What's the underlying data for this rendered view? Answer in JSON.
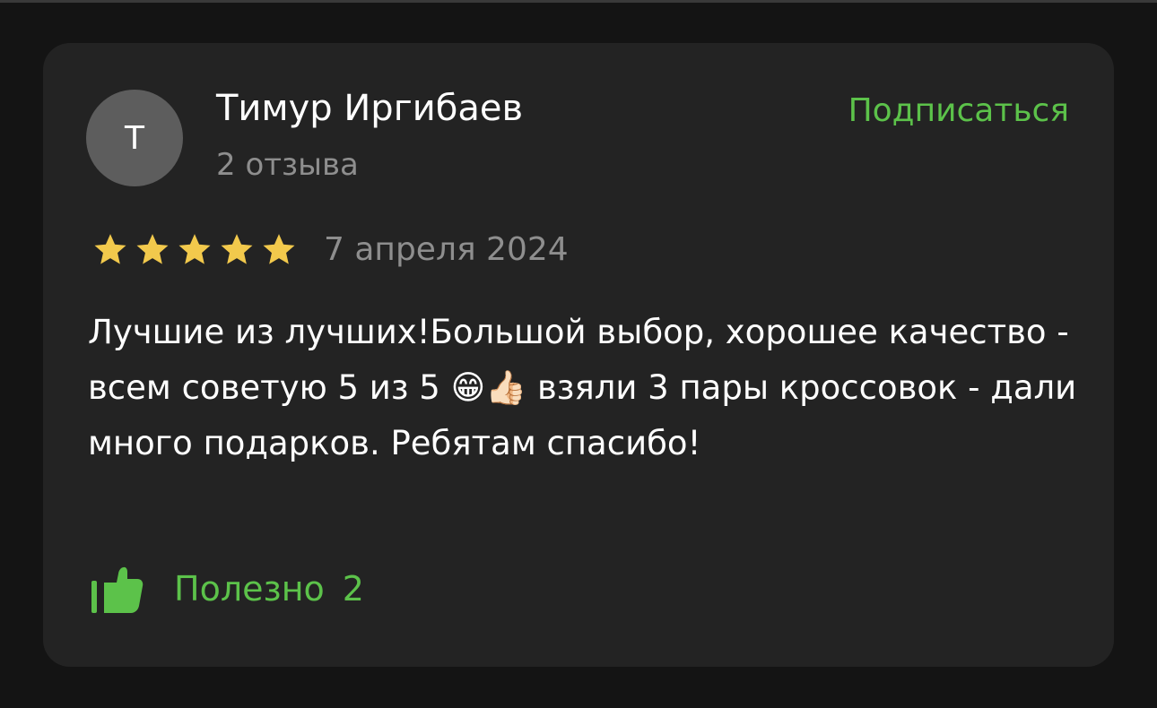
{
  "review": {
    "author": {
      "initial": "Т",
      "name": "Тимур Иргибаев",
      "reviews_count": "2 отзыва"
    },
    "subscribe_label": "Подписаться",
    "rating": 5,
    "rating_max": 5,
    "date": "7 апреля 2024",
    "text": "Лучшие из лучших!Большой выбор, хорошее качество - всем советую 5 из 5 😁👍🏻 взяли 3 пары кроссовок - дали много подарков. Ребятам спасибо!",
    "helpful": {
      "label": "Полезно",
      "count": "2"
    }
  },
  "colors": {
    "accent_green": "#5cc24a",
    "star_gold": "#f2c94c",
    "card_background": "#232323",
    "page_background": "#141414",
    "avatar_background": "#5d5d5d",
    "muted_text": "#8e8e8e"
  },
  "icons": {
    "rating_star": "star-icon",
    "helpful": "thumbs-up-icon"
  }
}
